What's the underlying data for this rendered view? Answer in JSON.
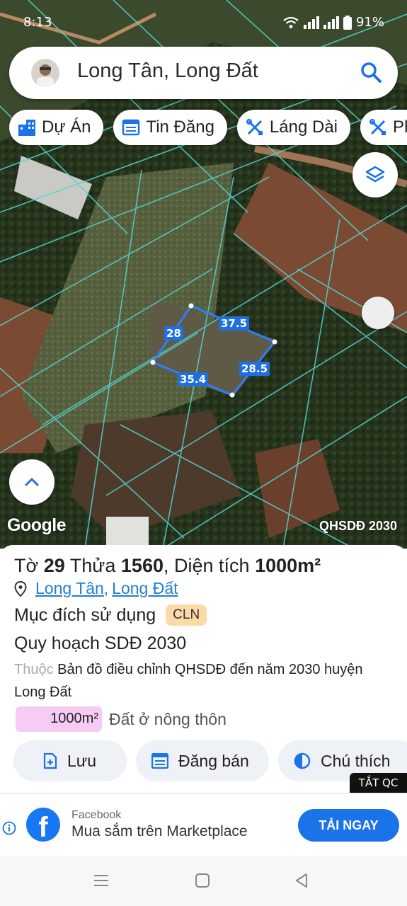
{
  "status_bar": {
    "time": "8:13",
    "battery": "91%"
  },
  "search": {
    "query": "Long Tân, Long Đất"
  },
  "chips": [
    {
      "label": "Dự Án",
      "icon": "buildings-icon"
    },
    {
      "label": "Tin Đăng",
      "icon": "calendar-list-icon"
    },
    {
      "label": "Láng Dài",
      "icon": "tools-icon"
    },
    {
      "label": "Ph",
      "icon": "tools-icon"
    }
  ],
  "map": {
    "brand": "Google",
    "plan_layer": "QHSDĐ 2030",
    "measurements": {
      "top": "37.5",
      "left": "28",
      "right": "28.5",
      "bottom": "35.4"
    }
  },
  "parcel": {
    "sheet_label": "Tờ",
    "sheet": "29",
    "plot_label": "Thửa",
    "plot": "1560",
    "area_label": ", Diện tích",
    "area": "1000m²",
    "location_links": [
      "Long Tân",
      "Long Đất"
    ],
    "location_sep": ",",
    "purpose_label": "Mục đích sử dụng",
    "purpose_code": "CLN",
    "plan_title": "Quy hoạch SDĐ 2030",
    "belongs_prefix": "Thuộc",
    "belongs_text": "Bản đồ điều chỉnh QHSDĐ đến năm 2030 huyện Long Đất",
    "area_chip": "1000m²",
    "land_type": "Đất ở nông thôn"
  },
  "actions": [
    {
      "label": "Lưu",
      "icon": "save-plus-icon"
    },
    {
      "label": "Đăng bán",
      "icon": "calendar-list-icon"
    },
    {
      "label": "Chú thích",
      "icon": "half-circle-icon"
    }
  ],
  "ad": {
    "close_label": "TẮT QC",
    "advertiser": "Facebook",
    "headline": "Mua sắm trên Marketplace",
    "cta": "TẢI NGAY",
    "brand_color": "#1877f2"
  }
}
